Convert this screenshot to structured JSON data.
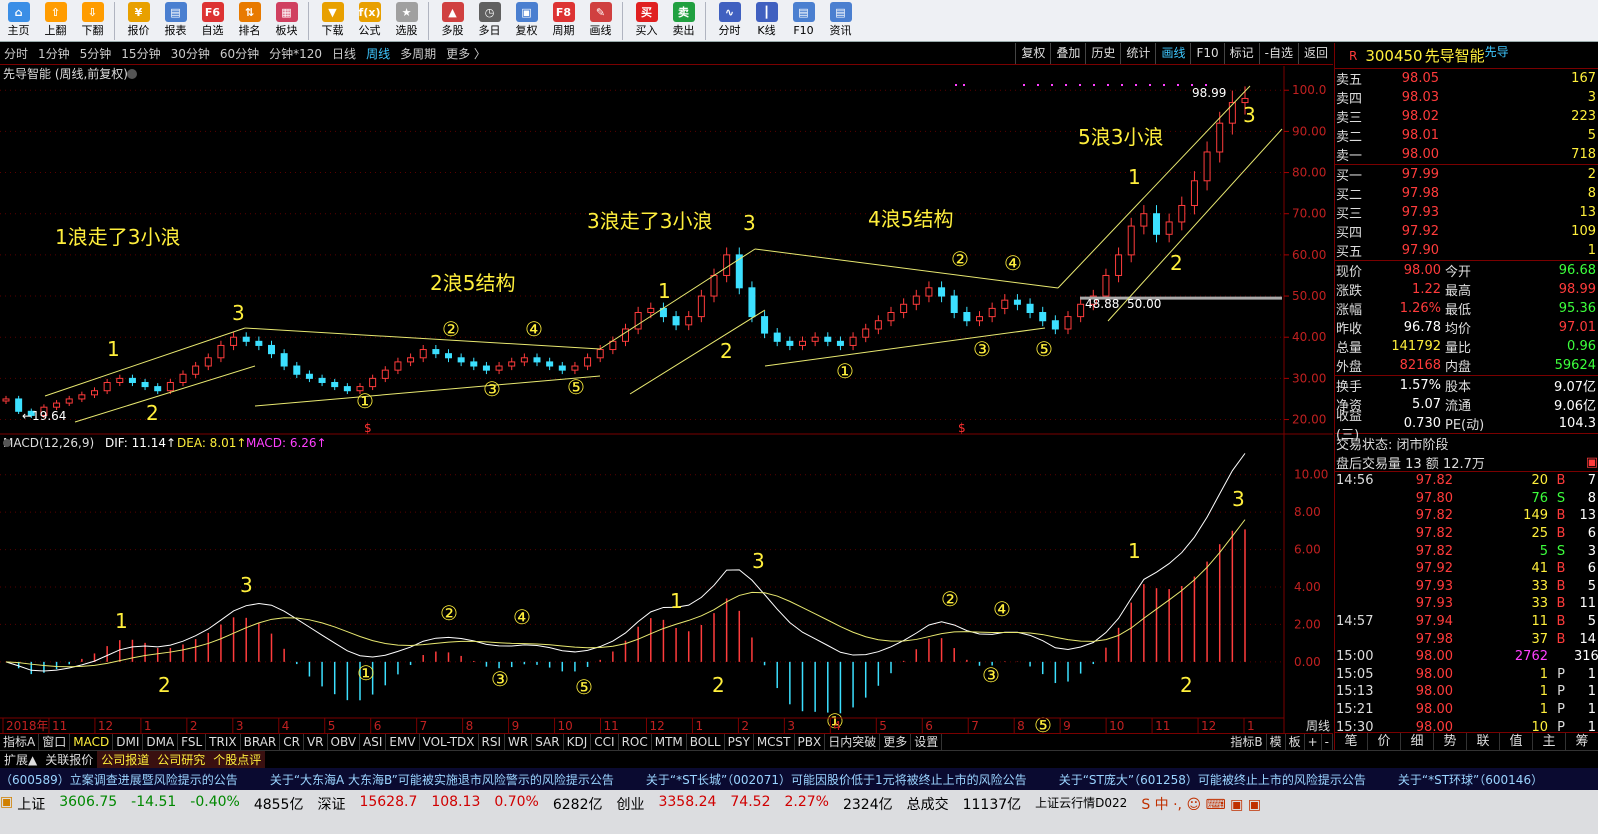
{
  "toolbar": [
    {
      "label": "主页",
      "icon": "home-icon",
      "color": "#3a8ee6"
    },
    {
      "label": "上翻",
      "icon": "arrow-up-icon",
      "color": "#ff9c00"
    },
    {
      "label": "下翻",
      "icon": "arrow-down-icon",
      "color": "#ff9c00"
    },
    {
      "label": "报价",
      "icon": "yen-icon",
      "color": "#e8a000"
    },
    {
      "label": "报表",
      "icon": "report-icon",
      "color": "#4a7fd0"
    },
    {
      "label": "自选",
      "icon": "f6-icon",
      "color": "#d33"
    },
    {
      "label": "排名",
      "icon": "ranking-icon",
      "color": "#e87a00"
    },
    {
      "label": "板块",
      "icon": "sector-icon",
      "color": "#d04060"
    },
    {
      "label": "下载",
      "icon": "download-icon",
      "color": "#e8a000"
    },
    {
      "label": "公式",
      "icon": "formula-icon",
      "color": "#e8a000"
    },
    {
      "label": "选股",
      "icon": "stock-pick-icon",
      "color": "#a0a0a0"
    },
    {
      "label": "多股",
      "icon": "multi-stock-icon",
      "color": "#d04040"
    },
    {
      "label": "多日",
      "icon": "multi-day-icon",
      "color": "#606060"
    },
    {
      "label": "复权",
      "icon": "adjust-icon",
      "color": "#4a7fd0"
    },
    {
      "label": "周期",
      "icon": "f8-icon",
      "color": "#d33"
    },
    {
      "label": "画线",
      "icon": "draw-line-icon",
      "color": "#d04040"
    },
    {
      "label": "买入",
      "icon": "buy-icon",
      "color": "#e02020"
    },
    {
      "label": "卖出",
      "icon": "sell-icon",
      "color": "#20a040"
    },
    {
      "label": "分时",
      "icon": "intraday-icon",
      "color": "#4060c0"
    },
    {
      "label": "K线",
      "icon": "kline-icon",
      "color": "#4060c0"
    },
    {
      "label": "F10",
      "icon": "f10-icon",
      "color": "#4a7fd0"
    },
    {
      "label": "资讯",
      "icon": "news-icon",
      "color": "#4a7fd0"
    }
  ],
  "toolbar_glyphs": [
    "⌂",
    "⇧",
    "⇩",
    "¥",
    "▤",
    "F6",
    "⇅",
    "▦",
    "▼",
    "f(x)",
    "★",
    "▲",
    "◷",
    "▣",
    "F8",
    "✎",
    "买",
    "卖",
    "∿",
    "┃",
    "▤",
    "▤"
  ],
  "periods": [
    "分时",
    "1分钟",
    "5分钟",
    "15分钟",
    "30分钟",
    "60分钟",
    "分钟*120",
    "日线",
    "周线",
    "多周期",
    "更多 〉"
  ],
  "period_active": "周线",
  "right_tools": [
    "复权",
    "叠加",
    "历史",
    "统计",
    "画线",
    "F10",
    "标记",
    "-自选",
    "返回"
  ],
  "right_tools_active": "画线",
  "chart_title": "先导智能 (周线,前复权)",
  "macd_label": "MACD(12,26,9)",
  "dif_label": "DIF: 11.14↑",
  "dea_label": "DEA: 8.01↑",
  "macd_value_label": "MACD: 6.26↑",
  "price_ticks": [
    "100.0",
    "90.00",
    "80.00",
    "70.00",
    "60.00",
    "50.00",
    "40.00",
    "30.00",
    "20.00"
  ],
  "macd_ticks": [
    "10.00",
    "8.00",
    "6.00",
    "4.00",
    "2.00",
    "0.00"
  ],
  "time_axis": [
    "2018年",
    "11",
    "12",
    "1",
    "2",
    "3",
    "4",
    "5",
    "6",
    "7",
    "8",
    "9",
    "10",
    "11",
    "12",
    "1",
    "2",
    "3",
    "4",
    "5",
    "6",
    "7",
    "8",
    "9",
    "10",
    "11",
    "12",
    "1",
    "周线"
  ],
  "annotations": {
    "wave1": "1浪走了3小浪",
    "wave2": "2浪5结构",
    "wave3": "3浪走了3小浪",
    "wave4": "4浪5结构",
    "wave5": "5浪3小浪",
    "n1": "1",
    "n2": "2",
    "n3": "3",
    "c1": "①",
    "c2": "②",
    "c3": "③",
    "c4": "④",
    "c5": "⑤",
    "s": "$",
    "low_price": "←19.64",
    "high_price": "98.99",
    "p4888": "48.88",
    "p5000": "50.00"
  },
  "chart_data": {
    "type": "candlestick",
    "title": "先导智能 (周线,前复权)",
    "period": "weekly",
    "ylim": [
      16,
      102
    ],
    "high": 98.99,
    "low": 19.64,
    "weekly_closes_approx": [
      25,
      22,
      21,
      23,
      24,
      25,
      26,
      27,
      29,
      30,
      29,
      28,
      27,
      29,
      31,
      33,
      35,
      38,
      40,
      39,
      38,
      36,
      33,
      31,
      30,
      29,
      28,
      27,
      28,
      30,
      32,
      34,
      35,
      37,
      36,
      35,
      34,
      33,
      32,
      33,
      34,
      35,
      34,
      33,
      32,
      33,
      35,
      37,
      39,
      42,
      46,
      47,
      45,
      43,
      45,
      50,
      55,
      60,
      52,
      45,
      41,
      39,
      38,
      39,
      40,
      39,
      38,
      40,
      42,
      44,
      46,
      48,
      50,
      52,
      50,
      46,
      44,
      45,
      47,
      49,
      48,
      46,
      44,
      42,
      45,
      48,
      50,
      55,
      60,
      67,
      70,
      65,
      68,
      72,
      78,
      85,
      92,
      97,
      98
    ],
    "macd": {
      "dif": 11.14,
      "dea": 8.01,
      "macd": 6.26,
      "ylim": [
        -3,
        11
      ]
    }
  },
  "stock": {
    "code_prefix": "R",
    "code": "300450",
    "name": "先导智能",
    "tag": "先导"
  },
  "orderbook": {
    "asks": [
      {
        "label": "卖五",
        "price": "98.05",
        "vol": "167"
      },
      {
        "label": "卖四",
        "price": "98.03",
        "vol": "3"
      },
      {
        "label": "卖三",
        "price": "98.02",
        "vol": "223"
      },
      {
        "label": "卖二",
        "price": "98.01",
        "vol": "5"
      },
      {
        "label": "卖一",
        "price": "98.00",
        "vol": "718"
      }
    ],
    "bids": [
      {
        "label": "买一",
        "price": "97.99",
        "vol": "2"
      },
      {
        "label": "买二",
        "price": "97.98",
        "vol": "8"
      },
      {
        "label": "买三",
        "price": "97.93",
        "vol": "13"
      },
      {
        "label": "买四",
        "price": "97.92",
        "vol": "109"
      },
      {
        "label": "买五",
        "price": "97.90",
        "vol": "1"
      }
    ]
  },
  "stats": [
    {
      "k": "现价",
      "v": "98.00",
      "vc": "red",
      "k2": "今开",
      "v2": "96.68",
      "v2c": "green"
    },
    {
      "k": "涨跌",
      "v": "1.22",
      "vc": "red",
      "k2": "最高",
      "v2": "98.99",
      "v2c": "red"
    },
    {
      "k": "涨幅",
      "v": "1.26%",
      "vc": "red",
      "k2": "最低",
      "v2": "95.36",
      "v2c": "green"
    },
    {
      "k": "昨收",
      "v": "96.78",
      "vc": "white",
      "k2": "均价",
      "v2": "97.01",
      "v2c": "red"
    },
    {
      "k": "总量",
      "v": "141792",
      "vc": "yellow",
      "k2": "量比",
      "v2": "0.96",
      "v2c": "green"
    },
    {
      "k": "外盘",
      "v": "82168",
      "vc": "red",
      "k2": "内盘",
      "v2": "59624",
      "v2c": "green"
    }
  ],
  "stats2": [
    {
      "k": "换手",
      "v": "1.57%",
      "k2": "股本",
      "v2": "9.07亿"
    },
    {
      "k": "净资",
      "v": "5.07",
      "k2": "流通",
      "v2": "9.06亿"
    },
    {
      "k": "收益(三)",
      "v": "0.730",
      "k2": "PE(动)",
      "v2": "104.3"
    }
  ],
  "trade_status": "交易状态: 闭市阶段",
  "after_hours": "盘后交易量 13 额 12.7万",
  "ticks": [
    {
      "t": "14:56",
      "p": "97.82",
      "vol": "20",
      "bs": "B",
      "n": "7"
    },
    {
      "t": "",
      "p": "97.80",
      "vol": "76",
      "bs": "S",
      "n": "8"
    },
    {
      "t": "",
      "p": "97.82",
      "vol": "149",
      "bs": "B",
      "n": "13"
    },
    {
      "t": "",
      "p": "97.82",
      "vol": "25",
      "bs": "B",
      "n": "6"
    },
    {
      "t": "",
      "p": "97.82",
      "vol": "5",
      "bs": "S",
      "n": "3"
    },
    {
      "t": "",
      "p": "97.92",
      "vol": "41",
      "bs": "B",
      "n": "6"
    },
    {
      "t": "",
      "p": "97.93",
      "vol": "33",
      "bs": "B",
      "n": "5"
    },
    {
      "t": "",
      "p": "97.93",
      "vol": "33",
      "bs": "B",
      "n": "11"
    },
    {
      "t": "14:57",
      "p": "97.94",
      "vol": "11",
      "bs": "B",
      "n": "5"
    },
    {
      "t": "",
      "p": "97.98",
      "vol": "37",
      "bs": "B",
      "n": "14"
    },
    {
      "t": "15:00",
      "p": "98.00",
      "vol": "2762",
      "bs": "",
      "n": "316"
    },
    {
      "t": "15:05",
      "p": "98.00",
      "vol": "1",
      "bs": "P",
      "n": "1"
    },
    {
      "t": "15:13",
      "p": "98.00",
      "vol": "1",
      "bs": "P",
      "n": "1"
    },
    {
      "t": "15:21",
      "p": "98.00",
      "vol": "1",
      "bs": "P",
      "n": "1"
    },
    {
      "t": "15:30",
      "p": "98.00",
      "vol": "10",
      "bs": "P",
      "n": "1"
    }
  ],
  "right_tabs": [
    "笔",
    "价",
    "细",
    "势",
    "联",
    "值",
    "主",
    "筹"
  ],
  "indicator_tabs": [
    "指标A",
    "窗口",
    "MACD",
    "DMI",
    "DMA",
    "FSL",
    "TRIX",
    "BRAR",
    "CR",
    "VR",
    "OBV",
    "ASI",
    "EMV",
    "VOL-TDX",
    "RSI",
    "WR",
    "SAR",
    "KDJ",
    "CCI",
    "ROC",
    "MTM",
    "BOLL",
    "PSY",
    "MCST",
    "PBX",
    "日内突破",
    "更多",
    "设置"
  ],
  "indicator_active": "MACD",
  "indicator_right": [
    "指标B",
    "模",
    "板",
    "+",
    "-"
  ],
  "info_tabs": [
    "扩展▲",
    "关联报价",
    "公司报道",
    "公司研究",
    "个股点评"
  ],
  "news": [
    "（600589）立案调查进展暨风险提示的公告",
    "关于“大东海A 大东海B”可能被实施退市风险警示的风险提示公告",
    "关于“*ST长城”（002071）可能因股价低于1元将被终止上市的风险公告",
    "关于“ST庞大”（601258）可能被终止上市的风险提示公告",
    "关于“*ST环球”（600146）"
  ],
  "status": [
    {
      "name": "上证",
      "val": "3606.75",
      "chg": "-14.51",
      "pct": "-0.40%",
      "amt": "4855亿"
    },
    {
      "name": "深证",
      "val": "15628.7",
      "chg": "108.13",
      "pct": "0.70%",
      "amt": "6282亿"
    },
    {
      "name": "创业",
      "val": "3358.24",
      "chg": "74.52",
      "pct": "2.27%",
      "amt": "2324亿"
    }
  ],
  "total_label": "总成交",
  "total_val": "11137亿",
  "cloud": "上证云行情D022"
}
